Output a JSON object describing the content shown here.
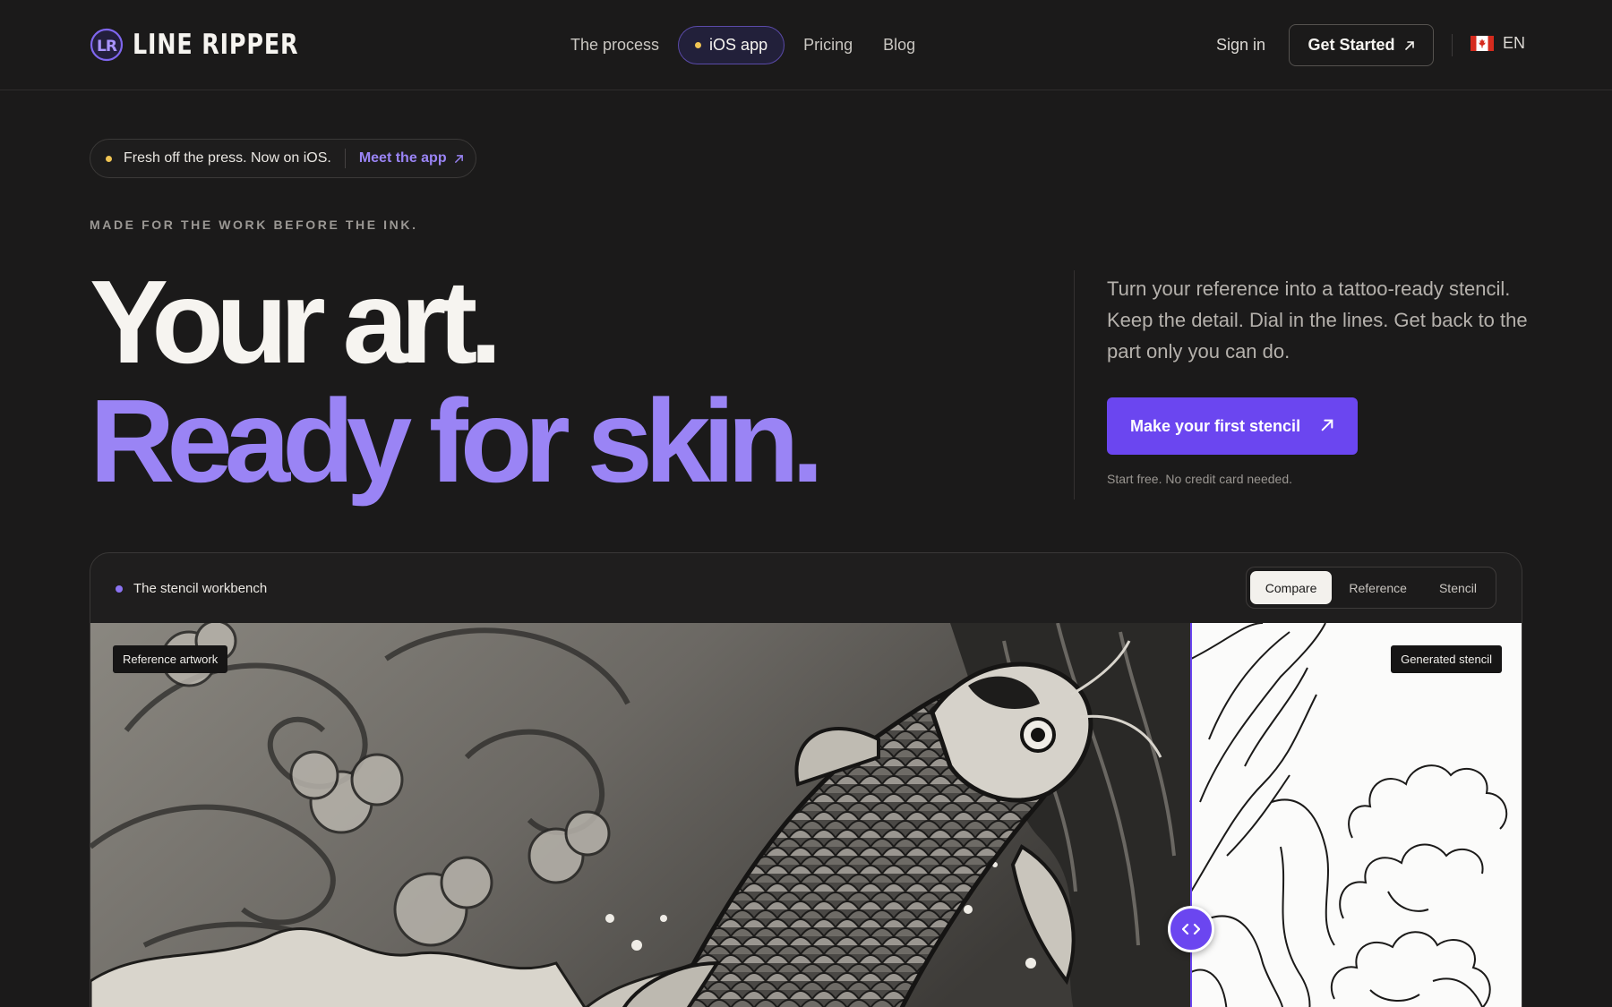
{
  "brand": {
    "name": "LINE RIPPER",
    "mark": "LR",
    "accent": "#6b46f0",
    "accent_light": "#9a84f5"
  },
  "nav": {
    "items": [
      {
        "label": "The process"
      },
      {
        "label": "iOS app",
        "highlighted": true
      },
      {
        "label": "Pricing"
      },
      {
        "label": "Blog"
      }
    ],
    "sign_in": "Sign in",
    "get_started": "Get Started",
    "language": "EN",
    "flag_icon": "canada-flag-icon"
  },
  "announcement": {
    "text": "Fresh off the press. Now on iOS.",
    "link": "Meet the app"
  },
  "hero": {
    "eyebrow": "MADE FOR THE WORK BEFORE THE INK.",
    "line1": "Your art.",
    "line2": "Ready for skin.",
    "description": "Turn your reference into a tattoo-ready stencil. Keep the detail. Dial in the lines. Get back to the part only you can do.",
    "cta": "Make your first stencil",
    "cta_note": "Start free. No credit card needed."
  },
  "workbench": {
    "title": "The stencil workbench",
    "tabs": [
      {
        "label": "Compare",
        "active": true
      },
      {
        "label": "Reference"
      },
      {
        "label": "Stencil"
      }
    ],
    "left_label": "Reference artwork",
    "right_label": "Generated stencil",
    "handle_icon": "code-arrows-icon"
  }
}
